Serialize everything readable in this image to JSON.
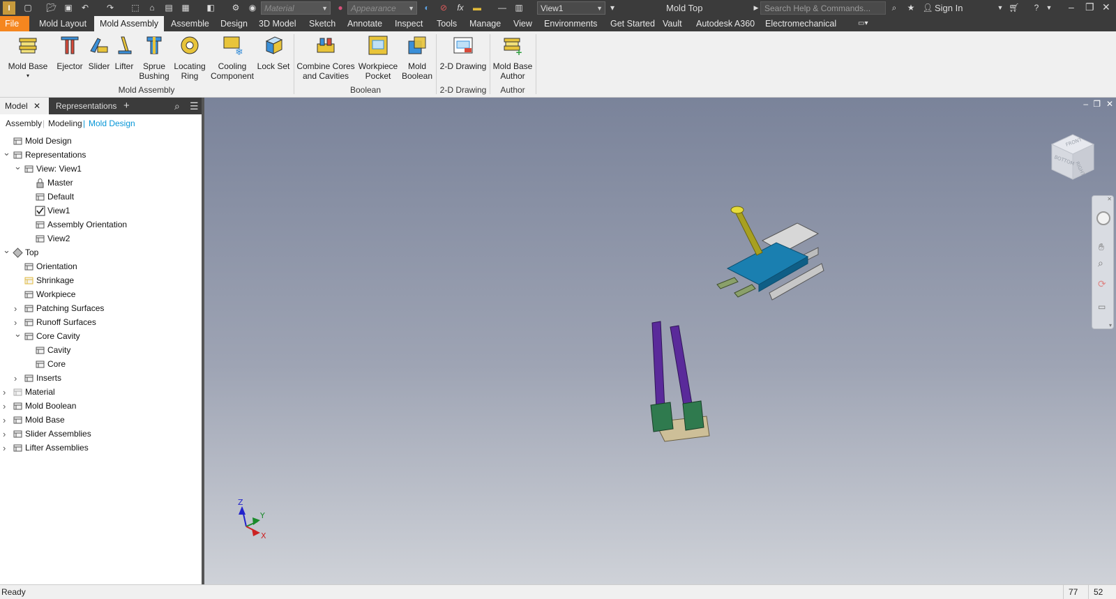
{
  "titlebar": {
    "material_placeholder": "Material",
    "appearance_placeholder": "Appearance",
    "view_combo": "View1",
    "document_title": "Mold Top",
    "search_placeholder": "Search Help & Commands...",
    "sign_in": "Sign In"
  },
  "menu": {
    "tabs": [
      "File",
      "Mold Layout",
      "Mold Assembly",
      "Assemble",
      "Design",
      "3D Model",
      "Sketch",
      "Annotate",
      "Inspect",
      "Tools",
      "Manage",
      "View",
      "Environments",
      "Get Started",
      "Vault",
      "Autodesk A360",
      "Electromechanical"
    ],
    "active_index": 2
  },
  "ribbon": {
    "groups": [
      {
        "label": "Mold Assembly",
        "buttons": [
          {
            "line1": "Mold Base",
            "line2": ""
          },
          {
            "line1": "Ejector",
            "line2": ""
          },
          {
            "line1": "Slider",
            "line2": ""
          },
          {
            "line1": "Lifter",
            "line2": ""
          },
          {
            "line1": "Sprue",
            "line2": "Bushing"
          },
          {
            "line1": "Locating",
            "line2": "Ring"
          },
          {
            "line1": "Cooling",
            "line2": "Component"
          },
          {
            "line1": "Lock Set",
            "line2": ""
          }
        ]
      },
      {
        "label": "Boolean",
        "buttons": [
          {
            "line1": "Combine Cores",
            "line2": "and Cavities"
          },
          {
            "line1": "Workpiece",
            "line2": "Pocket"
          },
          {
            "line1": "Mold",
            "line2": "Boolean"
          }
        ]
      },
      {
        "label": "2-D Drawing",
        "buttons": [
          {
            "line1": "2-D Drawing",
            "line2": ""
          }
        ]
      },
      {
        "label": "Author",
        "buttons": [
          {
            "line1": "Mold Base",
            "line2": "Author"
          }
        ]
      }
    ]
  },
  "browser": {
    "tab_model": "Model",
    "tab_representations": "Representations",
    "subtabs": [
      "Assembly",
      "Modeling",
      "Mold Design"
    ],
    "active_subtab": 2,
    "tree": [
      {
        "label": "Mold Design",
        "level": 0,
        "toggle": "",
        "icon": "mold-design-icon"
      },
      {
        "label": "Representations",
        "level": 0,
        "toggle": "open",
        "icon": "representations-icon"
      },
      {
        "label": "View: View1",
        "level": 1,
        "toggle": "open",
        "icon": "view-rep-icon"
      },
      {
        "label": "Master",
        "level": 2,
        "toggle": "",
        "icon": "lock-icon"
      },
      {
        "label": "Default",
        "level": 2,
        "toggle": "",
        "icon": "view-rep-icon"
      },
      {
        "label": "View1",
        "level": 2,
        "toggle": "",
        "icon": "checked-view-icon"
      },
      {
        "label": "Assembly Orientation",
        "level": 2,
        "toggle": "",
        "icon": "view-rep-icon"
      },
      {
        "label": "View2",
        "level": 2,
        "toggle": "",
        "icon": "view-rep-icon"
      },
      {
        "label": "Top",
        "level": 0,
        "toggle": "open",
        "icon": "top-icon"
      },
      {
        "label": "Orientation",
        "level": 1,
        "toggle": "",
        "icon": "orientation-icon"
      },
      {
        "label": "Shrinkage",
        "level": 1,
        "toggle": "",
        "icon": "shrinkage-icon"
      },
      {
        "label": "Workpiece",
        "level": 1,
        "toggle": "",
        "icon": "workpiece-icon"
      },
      {
        "label": "Patching Surfaces",
        "level": 1,
        "toggle": "closed",
        "icon": "patching-icon"
      },
      {
        "label": "Runoff Surfaces",
        "level": 1,
        "toggle": "closed",
        "icon": "runoff-icon"
      },
      {
        "label": "Core Cavity",
        "level": 1,
        "toggle": "open",
        "icon": "core-cavity-icon"
      },
      {
        "label": "Cavity",
        "level": 2,
        "toggle": "",
        "icon": "cavity-icon"
      },
      {
        "label": "Core",
        "level": 2,
        "toggle": "",
        "icon": "core-icon"
      },
      {
        "label": "Inserts",
        "level": 1,
        "toggle": "closed",
        "icon": "inserts-icon"
      },
      {
        "label": "Material",
        "level": 0,
        "toggle": "closed",
        "icon": "material-icon"
      },
      {
        "label": "Mold Boolean",
        "level": 0,
        "toggle": "closed",
        "icon": "mold-boolean-icon"
      },
      {
        "label": "Mold Base",
        "level": 0,
        "toggle": "closed",
        "icon": "mold-base-icon"
      },
      {
        "label": "Slider Assemblies",
        "level": 0,
        "toggle": "closed",
        "icon": "slider-assemblies-icon"
      },
      {
        "label": "Lifter Assemblies",
        "level": 0,
        "toggle": "closed",
        "icon": "lifter-assemblies-icon"
      }
    ]
  },
  "viewcube": {
    "top": "FRONT",
    "side": "RIGHT",
    "front": "BOTTOM"
  },
  "triad": {
    "x": "X",
    "y": "Y",
    "z": "Z"
  },
  "status": {
    "text": "Ready",
    "count_a": "77",
    "count_b": "52"
  },
  "colors": {
    "file_tab": "#f5861f",
    "accent_blue": "#0696d7",
    "dark_chrome": "#3b3b3b"
  }
}
